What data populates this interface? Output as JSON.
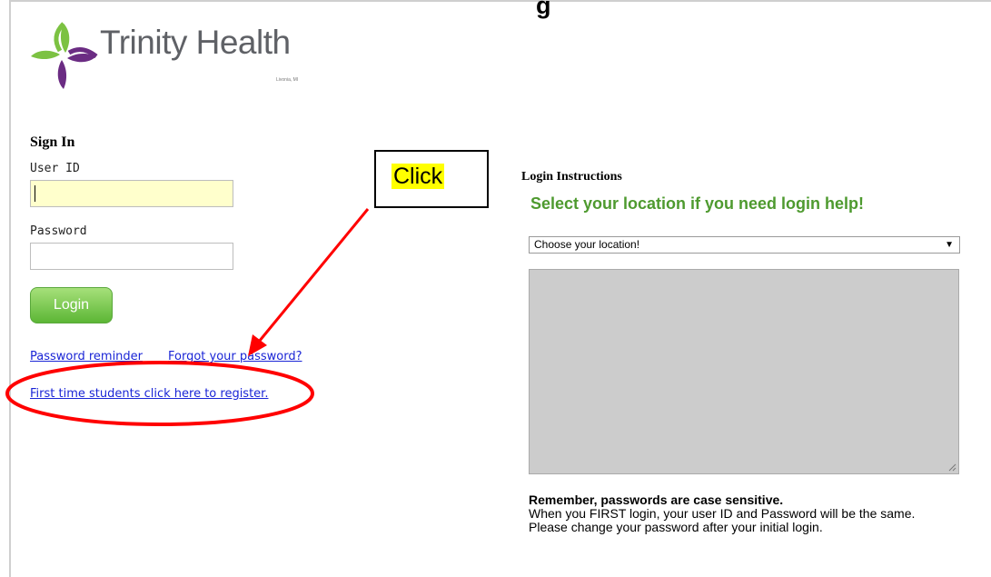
{
  "page_top_text": "g",
  "brand": {
    "name": "Trinity Health",
    "subtitle": "Livonia, MI",
    "colors": {
      "green": "#7cc242",
      "purple": "#6b2c83",
      "gray": "#5f6166"
    }
  },
  "signin": {
    "heading": "Sign In",
    "userid_label": "User ID",
    "userid_value": "",
    "password_label": "Password",
    "password_value": "",
    "login_label": "Login",
    "password_reminder": "Password reminder",
    "forgot_password": "Forgot your password?",
    "register_link": "First time students click here to register."
  },
  "annotation": {
    "label": "Click",
    "arrow_color": "#ff0000",
    "highlight_color": "#ffff00"
  },
  "instructions": {
    "heading": "Login Instructions",
    "subheading": "Select your location if you need login help!",
    "location_selected": "Choose your location!",
    "area_text": "",
    "remember_title": "Remember, passwords are case sensitive.",
    "remember_line1": "When you FIRST login, your user ID and Password will be the same.",
    "remember_line2": "Please change your password after your initial login."
  }
}
